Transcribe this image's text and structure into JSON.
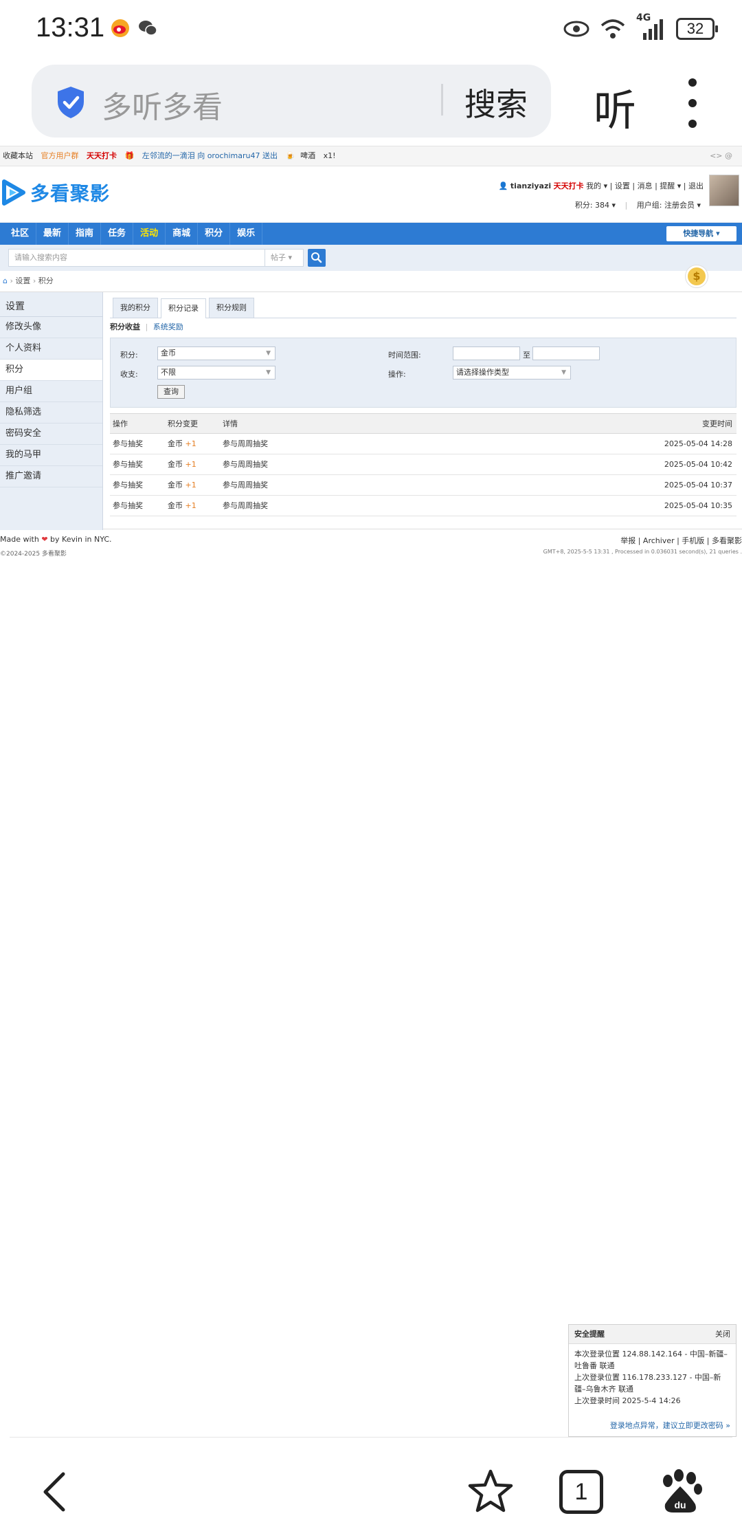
{
  "status_bar": {
    "time": "13:31",
    "battery": "32",
    "network": "4G",
    "icons": [
      "weibo-icon",
      "wechat-icon",
      "eye-icon",
      "wifi-icon",
      "signal-icon",
      "battery-icon"
    ]
  },
  "browser": {
    "url_text": "多听多看",
    "search_label": "搜索",
    "listen_label": "听"
  },
  "topstrip": {
    "fav": "收藏本站",
    "group": "官方用户群",
    "checkin": "天天打卡",
    "news": "左邻流的一滴泪 向 orochimaru47 送出",
    "gift": "啤酒",
    "gift_count": "x1!",
    "right": "<> @"
  },
  "header": {
    "logo": "多看聚影",
    "username": "tianziyazi",
    "checkin": "天天打卡",
    "links": "我的 ▾ | 设置 | 消息 | 提醒 ▾ | 退出",
    "points": "积分: 384 ▾",
    "usergroup": "用户组: 注册会员 ▾"
  },
  "nav": {
    "items": [
      "社区",
      "最新",
      "指南",
      "任务",
      "活动",
      "商城",
      "积分",
      "娱乐"
    ],
    "highlight_index": 4,
    "quicknav": "快捷导航 ▾"
  },
  "search": {
    "placeholder": "请输入搜索内容",
    "type": "帖子 ▾"
  },
  "breadcrumb": {
    "home": "⌂",
    "items": [
      "设置",
      "积分"
    ]
  },
  "sidebar": {
    "title": "设置",
    "items": [
      "修改头像",
      "个人资料",
      "积分",
      "用户组",
      "隐私筛选",
      "密码安全",
      "我的马甲",
      "推广邀请"
    ],
    "active_index": 2
  },
  "tabs": {
    "items": [
      "我的积分",
      "积分记录",
      "积分规则"
    ],
    "active_index": 1
  },
  "subtabs": {
    "current": "积分收益",
    "other": "系统奖励"
  },
  "filter": {
    "points_label": "积分:",
    "points_value": "金币",
    "income_label": "收支:",
    "income_value": "不限",
    "time_label": "时间范围:",
    "to_label": "至",
    "op_label": "操作:",
    "op_value": "请选择操作类型",
    "query_btn": "查询"
  },
  "table": {
    "headers": [
      "操作",
      "积分变更",
      "详情",
      "变更时间"
    ],
    "rows": [
      {
        "op": "参与抽奖",
        "currency": "金币",
        "delta": "+1",
        "detail": "参与周周抽奖",
        "time": "2025-05-04 14:28"
      },
      {
        "op": "参与抽奖",
        "currency": "金币",
        "delta": "+1",
        "detail": "参与周周抽奖",
        "time": "2025-05-04 10:42"
      },
      {
        "op": "参与抽奖",
        "currency": "金币",
        "delta": "+1",
        "detail": "参与周周抽奖",
        "time": "2025-05-04 10:37"
      },
      {
        "op": "参与抽奖",
        "currency": "金币",
        "delta": "+1",
        "detail": "参与周周抽奖",
        "time": "2025-05-04 10:35"
      }
    ]
  },
  "footer": {
    "made_with": "Made with",
    "made_by": "by Kevin in NYC.",
    "copyright": "©2024-2025 多看聚影",
    "links": "举报 | Archiver | 手机版 | 多看聚影",
    "processed": "GMT+8, 2025-5-5 13:31 , Processed in 0.036031 second(s), 21 queries ."
  },
  "security_popup": {
    "title": "安全提醒",
    "close": "关闭",
    "line1": "本次登录位置 124.88.142.164 - 中国–新疆–吐鲁番 联通",
    "line2": "上次登录位置 116.178.233.127 - 中国–新疆–乌鲁木齐 联通",
    "line3": "上次登录时间 2025-5-4 14:26",
    "link": "登录地点异常，建议立即更改密码 »"
  },
  "bottom_nav": {
    "tab_count": "1",
    "icons": [
      "back-icon",
      "star-icon",
      "tabs-icon",
      "baidu-icon"
    ]
  },
  "colors": {
    "nav_blue": "#2d7bd3",
    "logo_blue": "#1e88e5",
    "checkin_red": "#d40000",
    "plus_orange": "#e67e22"
  }
}
